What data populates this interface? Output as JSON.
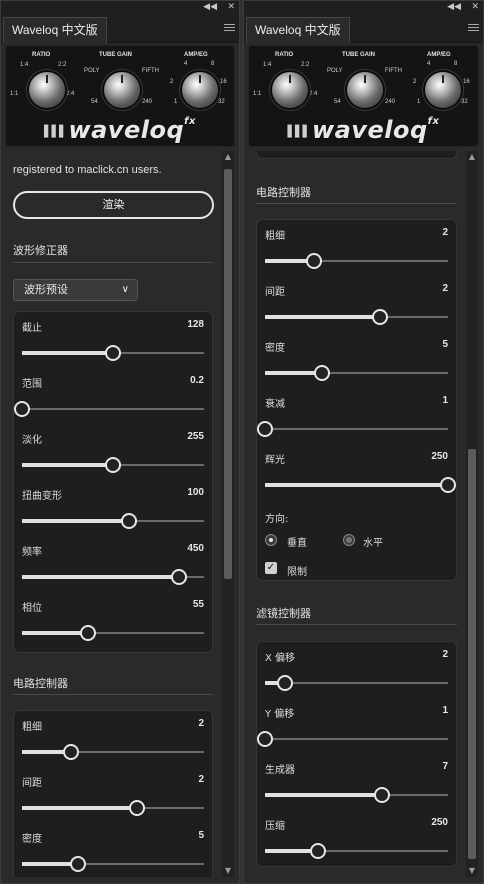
{
  "window": {
    "collapse_glyph": "◀◀",
    "close_glyph": "✕"
  },
  "left_panel": {
    "tab_title": "Waveloq 中文版",
    "header": {
      "knobs": [
        {
          "label": "RATIO",
          "ticks": [
            "1:4",
            "2:2",
            "1:1",
            "2:4"
          ]
        },
        {
          "label": "TUBE GAIN",
          "ticks": [
            "POLY",
            "FIFTH",
            "54",
            "240"
          ]
        },
        {
          "label": "AMP/EG",
          "ticks": [
            "4",
            "8",
            "2",
            "16",
            "1",
            "32"
          ]
        }
      ],
      "logo_text": "waveloq",
      "logo_suffix": "fx"
    },
    "registration_text": "registered to maclick.cn users.",
    "render_button": "渲染",
    "waveform_section": {
      "title": "波形修正器",
      "preset_dropdown": "波形预设",
      "sliders": [
        {
          "label": "截止",
          "value": "128",
          "fraction": 0.5
        },
        {
          "label": "范围",
          "value": "0.2",
          "fraction": 0.0
        },
        {
          "label": "淡化",
          "value": "255",
          "fraction": 0.5
        },
        {
          "label": "扭曲变形",
          "value": "100",
          "fraction": 0.59
        },
        {
          "label": "频率",
          "value": "450",
          "fraction": 0.86
        },
        {
          "label": "相位",
          "value": "55",
          "fraction": 0.36
        }
      ]
    },
    "circuit_section": {
      "title": "电路控制器",
      "sliders": [
        {
          "label": "粗细",
          "value": "2",
          "fraction": 0.27
        },
        {
          "label": "间距",
          "value": "2",
          "fraction": 0.63
        },
        {
          "label": "密度",
          "value": "5",
          "fraction": 0.31
        }
      ]
    }
  },
  "right_panel": {
    "tab_title": "Waveloq 中文版",
    "circuit_section": {
      "title": "电路控制器",
      "sliders": [
        {
          "label": "粗细",
          "value": "2",
          "fraction": 0.27
        },
        {
          "label": "间距",
          "value": "2",
          "fraction": 0.63
        },
        {
          "label": "密度",
          "value": "5",
          "fraction": 0.31
        },
        {
          "label": "衰减",
          "value": "1",
          "fraction": 0.0
        },
        {
          "label": "辉光",
          "value": "250",
          "fraction": 1.0
        }
      ],
      "direction_label": "方向:",
      "direction_options": [
        {
          "label": "垂直",
          "selected": true
        },
        {
          "label": "水平",
          "selected": false
        }
      ],
      "limit_checkbox": {
        "label": "限制",
        "checked": true
      }
    },
    "filter_section": {
      "title": "滤镜控制器",
      "sliders": [
        {
          "label": "X 偏移",
          "value": "2",
          "fraction": 0.11
        },
        {
          "label": "Y 偏移",
          "value": "1",
          "fraction": 0.0
        },
        {
          "label": "生成器",
          "value": "7",
          "fraction": 0.64
        },
        {
          "label": "压缩",
          "value": "250",
          "fraction": 0.29
        }
      ]
    }
  },
  "colors": {
    "panel_bg": "#2a2a2a",
    "group_bg": "#1e1e1e",
    "text": "#dcdcdc",
    "accent": "#e6e6e6"
  }
}
